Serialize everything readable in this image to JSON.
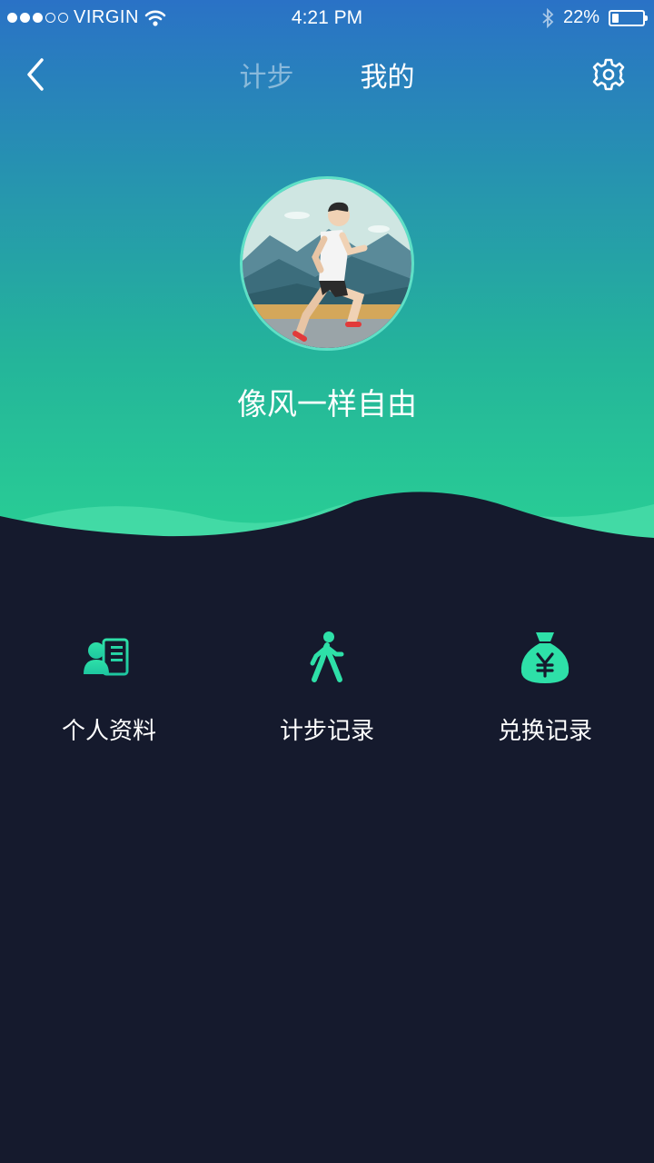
{
  "status_bar": {
    "carrier": "VIRGIN",
    "time": "4:21 PM",
    "battery": "22%",
    "battery_level": 0.22
  },
  "nav": {
    "tabs": [
      {
        "label": "计步",
        "active": false
      },
      {
        "label": "我的",
        "active": true
      }
    ]
  },
  "profile": {
    "username": "像风一样自由"
  },
  "menu": {
    "items": [
      {
        "label": "个人资料",
        "icon": "profile-card-icon"
      },
      {
        "label": "计步记录",
        "icon": "walking-icon"
      },
      {
        "label": "兑换记录",
        "icon": "money-bag-icon"
      }
    ]
  },
  "colors": {
    "accent": "#2ee0a0",
    "background": "#151a2d",
    "gradient_top": "#2a72c6",
    "gradient_bottom": "#2ad493"
  }
}
